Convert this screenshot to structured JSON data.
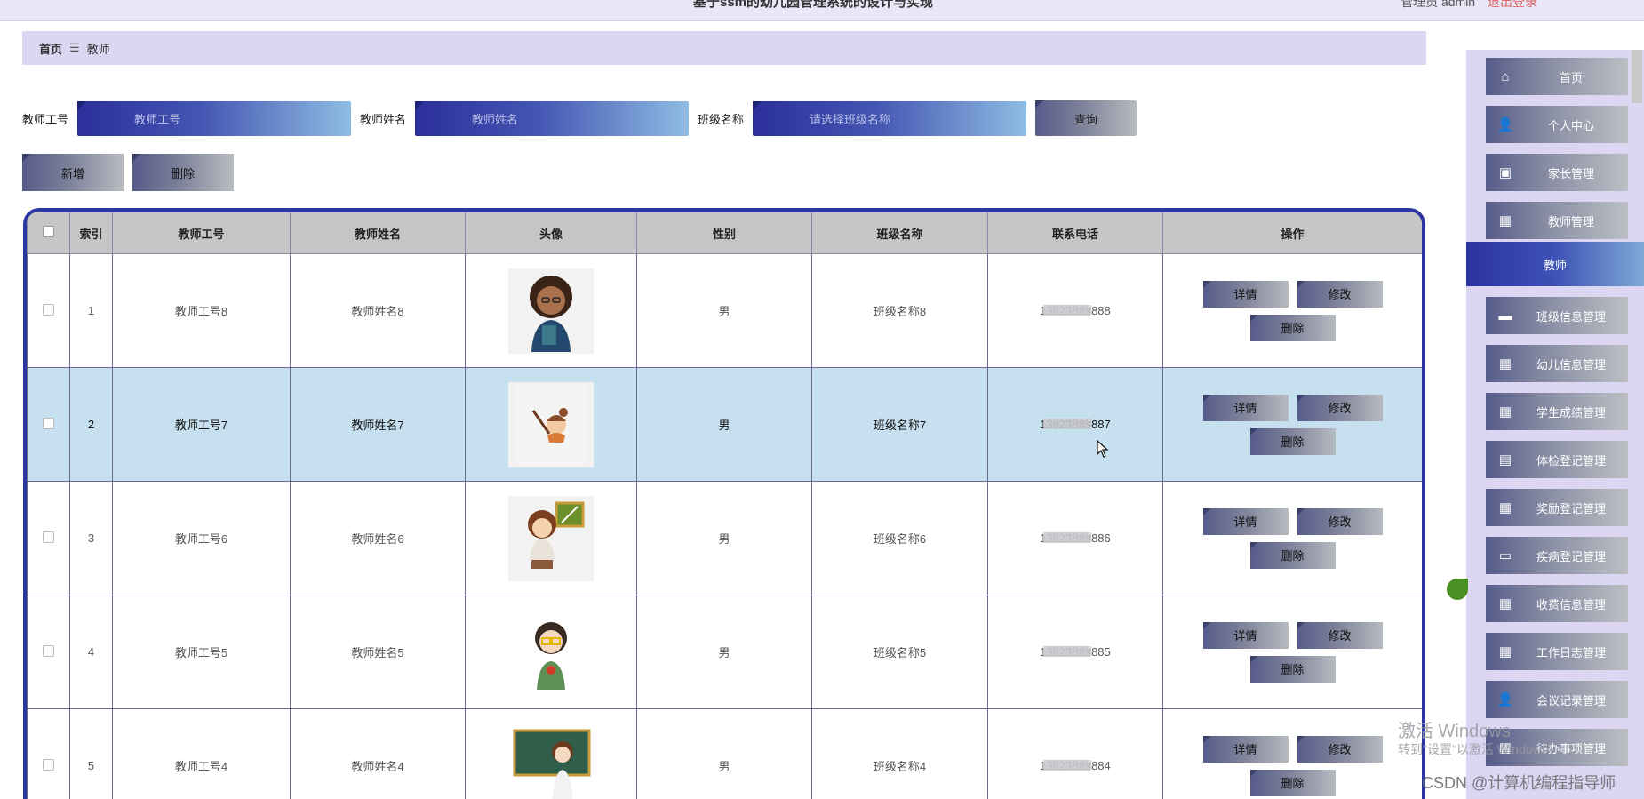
{
  "topbar": {
    "title": "基于ssm的幼儿园管理系统的设计与实现",
    "user": "管理员 admin",
    "logout": "退出登录"
  },
  "breadcrumb": {
    "home": "首页",
    "sep": "☰",
    "current": "教师"
  },
  "search": {
    "fields": [
      {
        "label": "教师工号",
        "placeholder": "教师工号"
      },
      {
        "label": "教师姓名",
        "placeholder": "教师姓名"
      },
      {
        "label": "班级名称",
        "placeholder": "请选择班级名称"
      }
    ],
    "query_label": "查询"
  },
  "actions": {
    "add": "新增",
    "delete": "删除"
  },
  "table": {
    "headers": [
      "",
      "索引",
      "教师工号",
      "教师姓名",
      "头像",
      "性别",
      "班级名称",
      "联系电话",
      "操作"
    ],
    "rows": [
      {
        "index": "1",
        "id": "教师工号8",
        "name": "教师姓名8",
        "gender": "男",
        "class": "班级名称8",
        "phone": "13823888888"
      },
      {
        "index": "2",
        "id": "教师工号7",
        "name": "教师姓名7",
        "gender": "男",
        "class": "班级名称7",
        "phone": "13823888887"
      },
      {
        "index": "3",
        "id": "教师工号6",
        "name": "教师姓名6",
        "gender": "男",
        "class": "班级名称6",
        "phone": "13823888886"
      },
      {
        "index": "4",
        "id": "教师工号5",
        "name": "教师姓名5",
        "gender": "男",
        "class": "班级名称5",
        "phone": "13823888885"
      },
      {
        "index": "5",
        "id": "教师工号4",
        "name": "教师姓名4",
        "gender": "男",
        "class": "班级名称4",
        "phone": "13823888884"
      }
    ],
    "ops": {
      "detail": "详情",
      "edit": "修改",
      "del": "删除"
    }
  },
  "sidebar": {
    "items": [
      {
        "label": "首页",
        "icon": "home-icon"
      },
      {
        "label": "个人中心",
        "icon": "user-icon"
      },
      {
        "label": "家长管理",
        "icon": "clipboard-icon"
      },
      {
        "label": "教师管理",
        "icon": "grid-icon"
      }
    ],
    "current": "教师",
    "items2": [
      {
        "label": "班级信息管理",
        "icon": "ticket-icon"
      },
      {
        "label": "幼儿信息管理",
        "icon": "grid-icon"
      },
      {
        "label": "学生成绩管理",
        "icon": "grid-icon"
      },
      {
        "label": "体检登记管理",
        "icon": "wallet-icon"
      },
      {
        "label": "奖励登记管理",
        "icon": "grid-icon"
      },
      {
        "label": "疾病登记管理",
        "icon": "monitor-icon"
      },
      {
        "label": "收费信息管理",
        "icon": "grid-icon"
      },
      {
        "label": "工作日志管理",
        "icon": "grid-icon"
      },
      {
        "label": "会议记录管理",
        "icon": "user-icon"
      },
      {
        "label": "待办事项管理",
        "icon": "grid-icon"
      }
    ]
  },
  "watermark": {
    "line1": "激活 Windows",
    "line2": "转到\"设置\"以激活 Windows。"
  },
  "csdn": "CSDN @计算机编程指导师"
}
